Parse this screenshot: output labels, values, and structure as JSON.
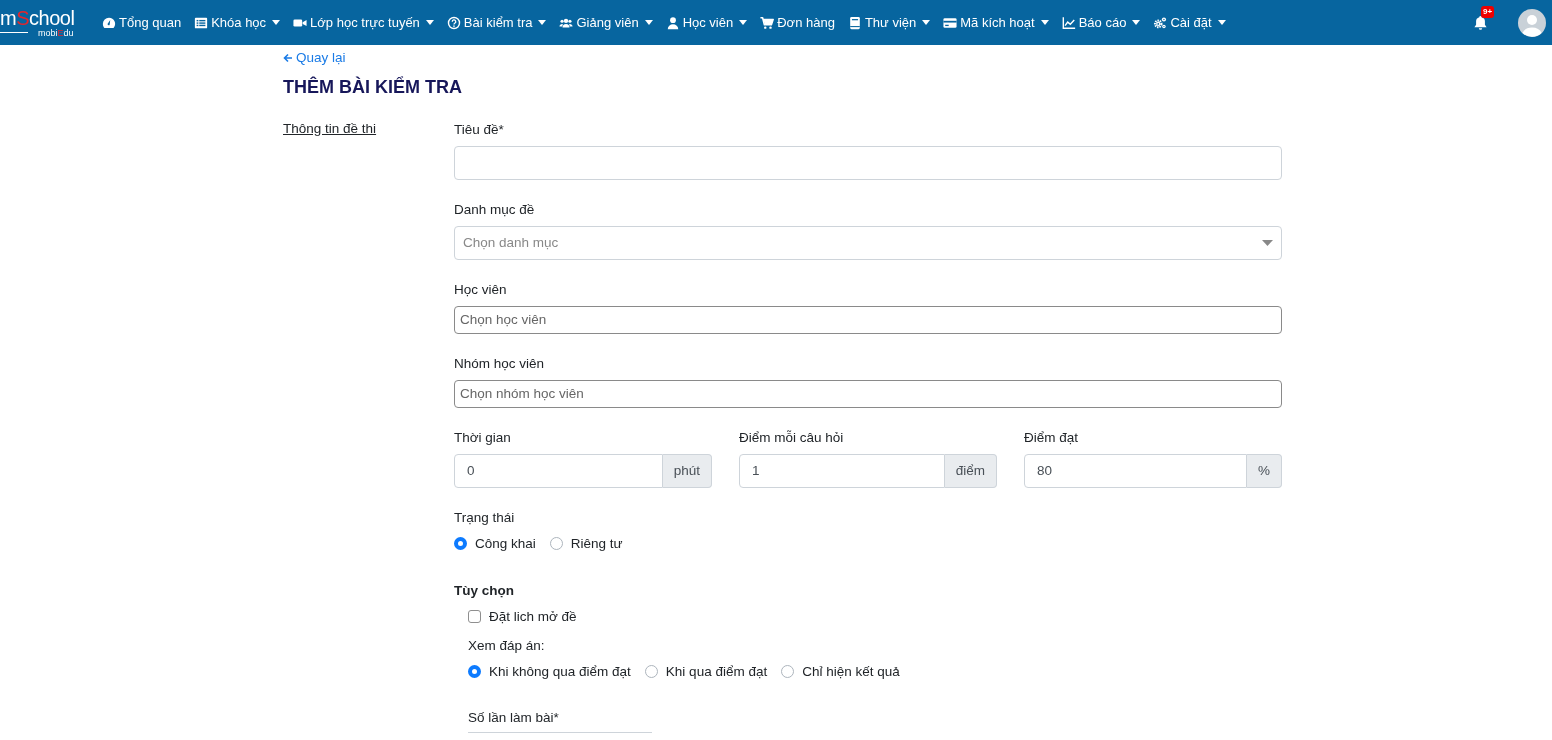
{
  "navbar": {
    "logo": {
      "title": [
        {
          "text": "m",
          "accent": false
        },
        {
          "text": "S",
          "accent": true
        },
        {
          "text": "chool",
          "accent": false
        }
      ],
      "subtitle": [
        {
          "text": "mobi",
          "accent": false
        },
        {
          "text": "E",
          "accent": true
        },
        {
          "text": "du",
          "accent": false
        }
      ]
    },
    "items": [
      {
        "kind": "gauge",
        "label": "Tổng quan",
        "dropdown": false
      },
      {
        "kind": "list",
        "label": "Khóa học",
        "dropdown": true
      },
      {
        "kind": "video",
        "label": "Lớp học trực tuyến",
        "dropdown": true
      },
      {
        "kind": "question",
        "label": "Bài kiểm tra",
        "dropdown": true
      },
      {
        "kind": "users",
        "label": "Giảng viên",
        "dropdown": true
      },
      {
        "kind": "user",
        "label": "Học viên",
        "dropdown": true
      },
      {
        "kind": "cart",
        "label": "Đơn hàng",
        "dropdown": false
      },
      {
        "kind": "book",
        "label": "Thư viện",
        "dropdown": true
      },
      {
        "kind": "card",
        "label": "Mã kích hoạt",
        "dropdown": true
      },
      {
        "kind": "chart",
        "label": "Báo cáo",
        "dropdown": true
      },
      {
        "kind": "gears",
        "label": "Cài đặt",
        "dropdown": true
      }
    ],
    "notifications": {
      "badge": "9+"
    }
  },
  "page": {
    "back_link": "Quay lại",
    "title": "THÊM BÀI KIỂM TRA",
    "section_label": "Thông tin đề thi",
    "fields": [
      {
        "kind": "text",
        "label": "Tiêu đề*"
      },
      {
        "kind": "select",
        "label": "Danh mục đề",
        "placeholder": "Chọn danh mục"
      },
      {
        "kind": "multi",
        "label": "Học viên",
        "placeholder": "Chọn học viên"
      },
      {
        "kind": "multi",
        "label": "Nhóm học viên",
        "placeholder": "Chọn nhóm học viên"
      },
      {
        "kind": "addons",
        "items": [
          {
            "label": "Thời gian",
            "value": "0",
            "unit": "phút"
          },
          {
            "label": "Điểm mỗi câu hỏi",
            "value": "1",
            "unit": "điểm"
          },
          {
            "label": "Điểm đạt",
            "value": "80",
            "unit": "%"
          }
        ]
      },
      {
        "kind": "radios",
        "label": "Trạng thái",
        "options": [
          {
            "label": "Công khai",
            "selected": true
          },
          {
            "label": "Riêng tư",
            "selected": false
          }
        ]
      },
      {
        "kind": "heading",
        "label": "Tùy chọn"
      },
      {
        "kind": "checkbox",
        "label": "Đặt lich mở đề",
        "checked": false
      },
      {
        "kind": "radios",
        "label": "Xem đáp án:",
        "indent": true,
        "options": [
          {
            "label": "Khi không qua điểm đạt",
            "selected": true
          },
          {
            "label": "Khi qua điểm đạt",
            "selected": false
          },
          {
            "label": "Chỉ hiện kết quả",
            "selected": false
          }
        ]
      },
      {
        "kind": "number",
        "label": "Số lần làm bài*",
        "indent": true
      }
    ]
  }
}
